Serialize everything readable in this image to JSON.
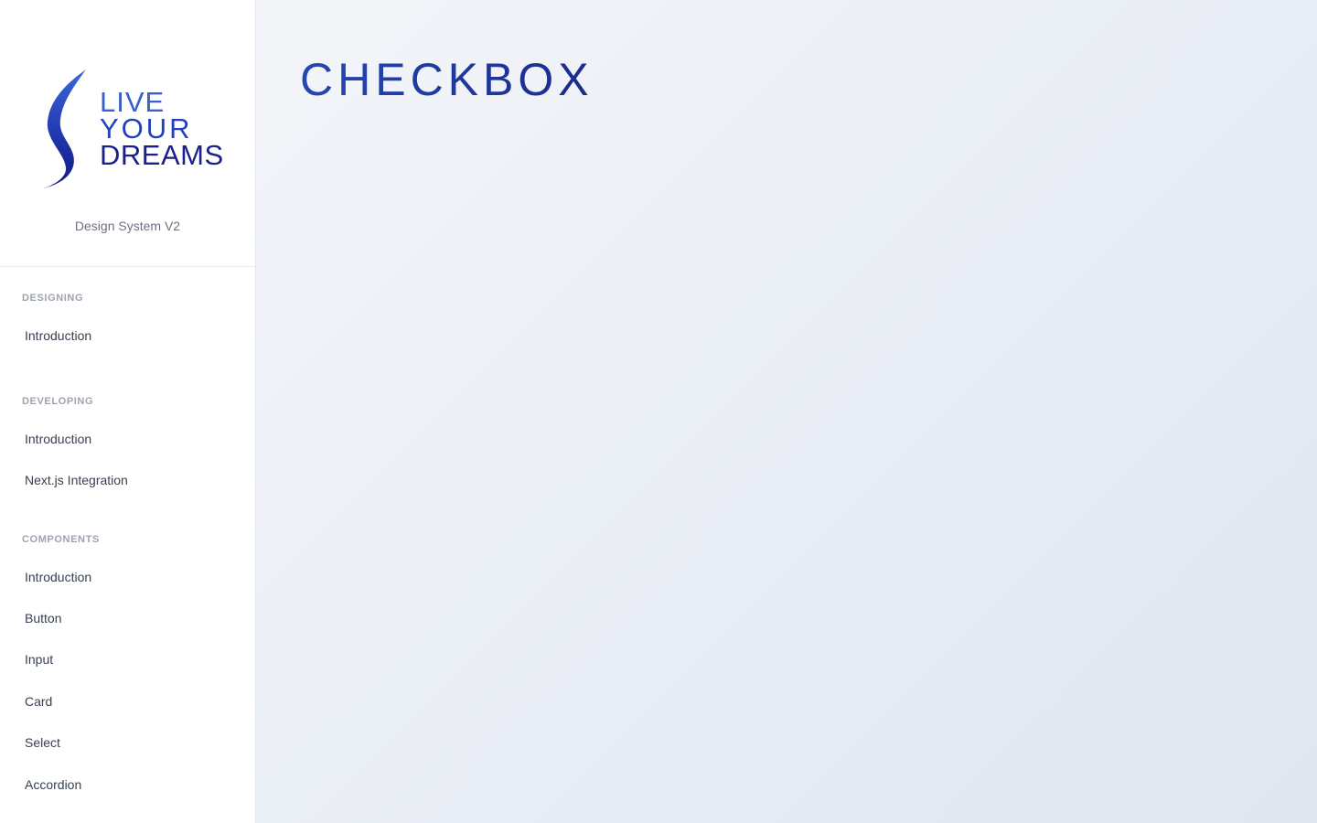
{
  "brand": {
    "logo_lines": [
      "LIVE",
      "YOUR",
      "DREAMS"
    ],
    "subtitle": "Design System V2"
  },
  "nav": {
    "sections": [
      {
        "title": "DESIGNING",
        "items": [
          "Introduction"
        ]
      },
      {
        "title": "DEVELOPING",
        "items": [
          "Introduction",
          "Next.js Integration"
        ]
      },
      {
        "title": "COMPONENTS",
        "items": [
          "Introduction",
          "Button",
          "Input",
          "Card",
          "Select",
          "Accordion"
        ]
      }
    ]
  },
  "main": {
    "title": "CHECKBOX"
  },
  "colors": {
    "accent": "#1f3aa0",
    "logo_light": "#3b5fcc",
    "logo_dark": "#1a1f8a",
    "section_title": "#9ca3af",
    "nav_text": "#374151"
  }
}
